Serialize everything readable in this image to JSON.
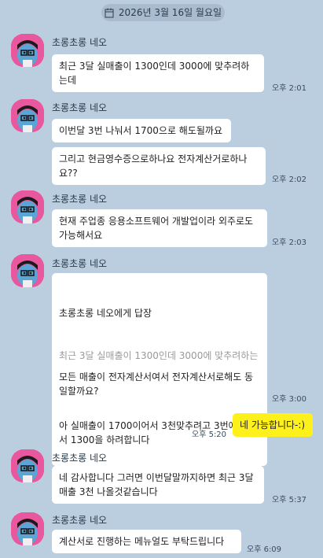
{
  "date_divider": "2026년 3월 16일 월요일",
  "sender_name": "초롱초롱 네오",
  "messages": [
    {
      "text": "최근 3달 실매출이 1300인데 3000에 맞추려하는데",
      "time": "오후 2:01"
    },
    {
      "text": "이번달 3번 나눠서 1700으로 해도될까요"
    },
    {
      "text": "그리고 현금영수증으로하나요 전자계산거로하나요??",
      "time": "오후 2:02"
    },
    {
      "text": "현재 주업종 응용소프트웨어 개발업이라 외주로도 가능해서요",
      "time": "오후 2:03"
    },
    {
      "reply_header": "초롱초롱 네오에게 답장",
      "reply_quote": "최근 3달 실매출이 1300인데 3000에 맞추려하는데",
      "text": "아 실매출이 1700이어서 3천맞추려고 3번에 나눠서 1300을 하려합니다"
    },
    {
      "text": "모든 매출이 전자계산서여서 전자계산서로해도 동일할까요?",
      "time": "오후 3:00"
    },
    {
      "text": "네 가능합니다-:)",
      "time": "오후 5:20"
    },
    {
      "text": "네 감사합니다 그러면 이번달말까지하면 최근 3달 매출 3천 나올것같습니다",
      "time": "오후 5:37"
    },
    {
      "text": "계산서로 진행하는 메뉴얼도 부탁드립니다",
      "time": "오후 6:09"
    }
  ],
  "colors": {
    "background": "#bacee0",
    "my_bubble": "#fef01b",
    "their_bubble": "#ffffff",
    "avatar": "#e9579e"
  },
  "icons": {
    "date": "calendar-icon",
    "avatar": "neo-character-avatar"
  }
}
